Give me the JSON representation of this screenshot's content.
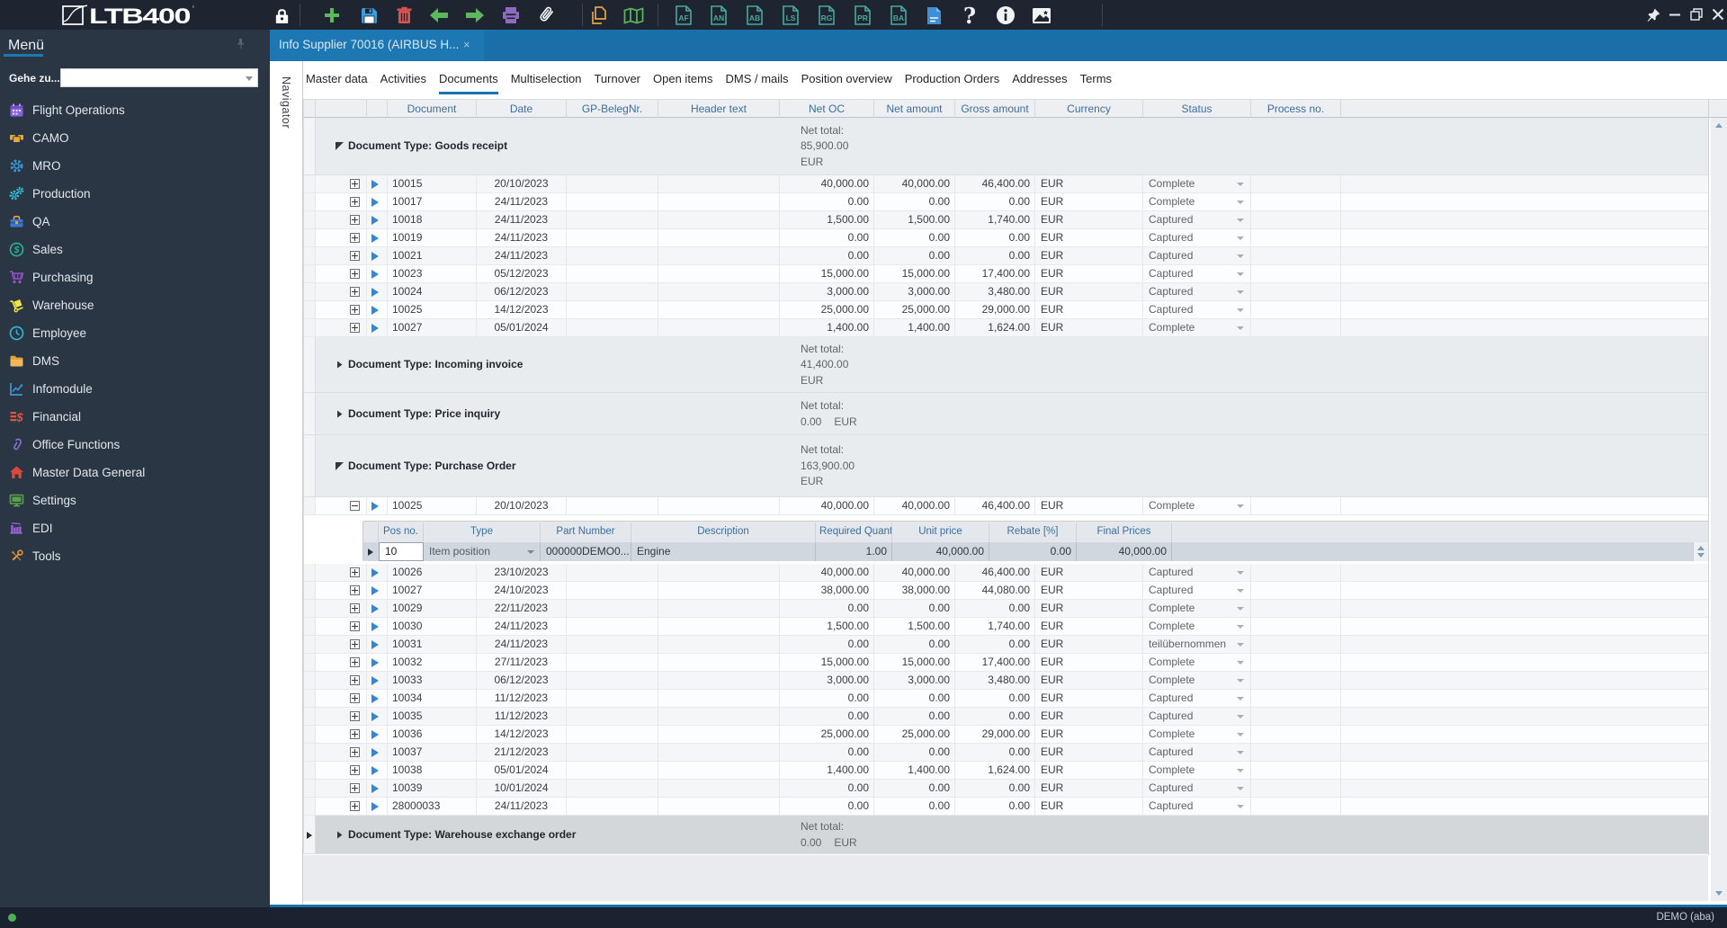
{
  "window": {
    "logo_text": "LTB400",
    "buttons": {
      "pin": "pin",
      "minimize": "minimize",
      "restore": "restore",
      "close": "close"
    }
  },
  "toolbar": {
    "doc_icon_letters": [
      "AF",
      "AN",
      "AB",
      "LS",
      "RG",
      "PR",
      "BA"
    ]
  },
  "sidebar": {
    "title": "Menü",
    "goto_label": "Gehe zu...",
    "goto_value": "",
    "items": [
      {
        "label": "Flight Operations",
        "icon": "calendar"
      },
      {
        "label": "CAMO",
        "icon": "camo"
      },
      {
        "label": "MRO",
        "icon": "gear"
      },
      {
        "label": "Production",
        "icon": "gears"
      },
      {
        "label": "QA",
        "icon": "toolbox"
      },
      {
        "label": "Sales",
        "icon": "dollar-circle"
      },
      {
        "label": "Purchasing",
        "icon": "cart"
      },
      {
        "label": "Warehouse",
        "icon": "forklift"
      },
      {
        "label": "Employee",
        "icon": "clock"
      },
      {
        "label": "DMS",
        "icon": "folder"
      },
      {
        "label": "Infomodule",
        "icon": "chart"
      },
      {
        "label": "Financial",
        "icon": "finance"
      },
      {
        "label": "Office Functions",
        "icon": "paperclip"
      },
      {
        "label": "Master Data General",
        "icon": "house"
      },
      {
        "label": "Settings",
        "icon": "monitor"
      },
      {
        "label": "EDI",
        "icon": "edi"
      },
      {
        "label": "Tools",
        "icon": "tools"
      }
    ]
  },
  "document_tab": {
    "title": "Info Supplier 70016 (AIRBUS H...",
    "close": "×"
  },
  "navigator_label": "Navigator",
  "page_tabs": {
    "active": "Documents",
    "items": [
      "Master data",
      "Activities",
      "Documents",
      "Multiselection",
      "Turnover",
      "Open items",
      "DMS / mails",
      "Position overview",
      "Production Orders",
      "Addresses",
      "Terms"
    ]
  },
  "grid": {
    "columns": [
      "Document",
      "Date",
      "GP-BelegNr.",
      "Header text",
      "Net OC",
      "Net amount",
      "Gross amount",
      "Currency",
      "Status",
      "Process no."
    ],
    "groups": [
      {
        "label": "Document Type: Goods receipt",
        "expanded": true,
        "selected": false,
        "net_total_lines": [
          "Net total:",
          "85,900.00",
          "EUR"
        ],
        "rows": [
          {
            "document": "10015",
            "date": "20/10/2023",
            "gp_belegnr": "",
            "header_text": "",
            "net_oc": "40,000.00",
            "net_amount": "40,000.00",
            "gross_amount": "46,400.00",
            "currency": "EUR",
            "status": "Complete",
            "process_no": ""
          },
          {
            "document": "10017",
            "date": "24/11/2023",
            "gp_belegnr": "",
            "header_text": "",
            "net_oc": "0.00",
            "net_amount": "0.00",
            "gross_amount": "0.00",
            "currency": "EUR",
            "status": "Complete",
            "process_no": ""
          },
          {
            "document": "10018",
            "date": "24/11/2023",
            "gp_belegnr": "",
            "header_text": "",
            "net_oc": "1,500.00",
            "net_amount": "1,500.00",
            "gross_amount": "1,740.00",
            "currency": "EUR",
            "status": "Captured",
            "process_no": ""
          },
          {
            "document": "10019",
            "date": "24/11/2023",
            "gp_belegnr": "",
            "header_text": "",
            "net_oc": "0.00",
            "net_amount": "0.00",
            "gross_amount": "0.00",
            "currency": "EUR",
            "status": "Captured",
            "process_no": ""
          },
          {
            "document": "10021",
            "date": "24/11/2023",
            "gp_belegnr": "",
            "header_text": "",
            "net_oc": "0.00",
            "net_amount": "0.00",
            "gross_amount": "0.00",
            "currency": "EUR",
            "status": "Captured",
            "process_no": ""
          },
          {
            "document": "10023",
            "date": "05/12/2023",
            "gp_belegnr": "",
            "header_text": "",
            "net_oc": "15,000.00",
            "net_amount": "15,000.00",
            "gross_amount": "17,400.00",
            "currency": "EUR",
            "status": "Captured",
            "process_no": ""
          },
          {
            "document": "10024",
            "date": "06/12/2023",
            "gp_belegnr": "",
            "header_text": "",
            "net_oc": "3,000.00",
            "net_amount": "3,000.00",
            "gross_amount": "3,480.00",
            "currency": "EUR",
            "status": "Captured",
            "process_no": ""
          },
          {
            "document": "10025",
            "date": "14/12/2023",
            "gp_belegnr": "",
            "header_text": "",
            "net_oc": "25,000.00",
            "net_amount": "25,000.00",
            "gross_amount": "29,000.00",
            "currency": "EUR",
            "status": "Captured",
            "process_no": ""
          },
          {
            "document": "10027",
            "date": "05/01/2024",
            "gp_belegnr": "",
            "header_text": "",
            "net_oc": "1,400.00",
            "net_amount": "1,400.00",
            "gross_amount": "1,624.00",
            "currency": "EUR",
            "status": "Complete",
            "process_no": ""
          }
        ]
      },
      {
        "label": "Document Type: Incoming invoice",
        "expanded": false,
        "selected": false,
        "net_total_lines": [
          "Net total:",
          "41,400.00",
          "EUR"
        ],
        "rows": []
      },
      {
        "label": "Document Type: Price inquiry",
        "expanded": false,
        "selected": false,
        "net_total_lines": [
          "Net total:",
          "0.00|EUR"
        ],
        "rows": []
      },
      {
        "label": "Document Type: Purchase Order",
        "expanded": true,
        "selected": false,
        "net_total_lines": [
          "Net total:",
          "163,900.00",
          "EUR"
        ],
        "rows": [
          {
            "document": "10025",
            "date": "20/10/2023",
            "gp_belegnr": "",
            "header_text": "",
            "net_oc": "40,000.00",
            "net_amount": "40,000.00",
            "gross_amount": "46,400.00",
            "currency": "EUR",
            "status": "Complete",
            "process_no": "",
            "expanded_detail": true
          },
          {
            "document": "10026",
            "date": "23/10/2023",
            "gp_belegnr": "",
            "header_text": "",
            "net_oc": "40,000.00",
            "net_amount": "40,000.00",
            "gross_amount": "46,400.00",
            "currency": "EUR",
            "status": "Captured",
            "process_no": ""
          },
          {
            "document": "10027",
            "date": "24/10/2023",
            "gp_belegnr": "",
            "header_text": "",
            "net_oc": "38,000.00",
            "net_amount": "38,000.00",
            "gross_amount": "44,080.00",
            "currency": "EUR",
            "status": "Captured",
            "process_no": ""
          },
          {
            "document": "10029",
            "date": "22/11/2023",
            "gp_belegnr": "",
            "header_text": "",
            "net_oc": "0.00",
            "net_amount": "0.00",
            "gross_amount": "0.00",
            "currency": "EUR",
            "status": "Complete",
            "process_no": ""
          },
          {
            "document": "10030",
            "date": "24/11/2023",
            "gp_belegnr": "",
            "header_text": "",
            "net_oc": "1,500.00",
            "net_amount": "1,500.00",
            "gross_amount": "1,740.00",
            "currency": "EUR",
            "status": "Complete",
            "process_no": ""
          },
          {
            "document": "10031",
            "date": "24/11/2023",
            "gp_belegnr": "",
            "header_text": "",
            "net_oc": "0.00",
            "net_amount": "0.00",
            "gross_amount": "0.00",
            "currency": "EUR",
            "status": "teilübernommen",
            "process_no": ""
          },
          {
            "document": "10032",
            "date": "27/11/2023",
            "gp_belegnr": "",
            "header_text": "",
            "net_oc": "15,000.00",
            "net_amount": "15,000.00",
            "gross_amount": "17,400.00",
            "currency": "EUR",
            "status": "Complete",
            "process_no": ""
          },
          {
            "document": "10033",
            "date": "06/12/2023",
            "gp_belegnr": "",
            "header_text": "",
            "net_oc": "3,000.00",
            "net_amount": "3,000.00",
            "gross_amount": "3,480.00",
            "currency": "EUR",
            "status": "Complete",
            "process_no": ""
          },
          {
            "document": "10034",
            "date": "11/12/2023",
            "gp_belegnr": "",
            "header_text": "",
            "net_oc": "0.00",
            "net_amount": "0.00",
            "gross_amount": "0.00",
            "currency": "EUR",
            "status": "Captured",
            "process_no": ""
          },
          {
            "document": "10035",
            "date": "11/12/2023",
            "gp_belegnr": "",
            "header_text": "",
            "net_oc": "0.00",
            "net_amount": "0.00",
            "gross_amount": "0.00",
            "currency": "EUR",
            "status": "Captured",
            "process_no": ""
          },
          {
            "document": "10036",
            "date": "14/12/2023",
            "gp_belegnr": "",
            "header_text": "",
            "net_oc": "25,000.00",
            "net_amount": "25,000.00",
            "gross_amount": "29,000.00",
            "currency": "EUR",
            "status": "Complete",
            "process_no": ""
          },
          {
            "document": "10037",
            "date": "21/12/2023",
            "gp_belegnr": "",
            "header_text": "",
            "net_oc": "0.00",
            "net_amount": "0.00",
            "gross_amount": "0.00",
            "currency": "EUR",
            "status": "Captured",
            "process_no": ""
          },
          {
            "document": "10038",
            "date": "05/01/2024",
            "gp_belegnr": "",
            "header_text": "",
            "net_oc": "1,400.00",
            "net_amount": "1,400.00",
            "gross_amount": "1,624.00",
            "currency": "EUR",
            "status": "Complete",
            "process_no": ""
          },
          {
            "document": "10039",
            "date": "10/01/2024",
            "gp_belegnr": "",
            "header_text": "",
            "net_oc": "0.00",
            "net_amount": "0.00",
            "gross_amount": "0.00",
            "currency": "EUR",
            "status": "Captured",
            "process_no": ""
          },
          {
            "document": "28000033",
            "date": "24/11/2023",
            "gp_belegnr": "",
            "header_text": "",
            "net_oc": "0.00",
            "net_amount": "0.00",
            "gross_amount": "0.00",
            "currency": "EUR",
            "status": "Captured",
            "process_no": ""
          }
        ]
      },
      {
        "label": "Document Type: Warehouse exchange order",
        "expanded": false,
        "selected": true,
        "net_total_lines": [
          "Net total:",
          "0.00|EUR"
        ],
        "rows": []
      }
    ]
  },
  "subgrid": {
    "columns": [
      "Pos no.",
      "Type",
      "Part Number",
      "Description",
      "Required Quantity",
      "Unit price",
      "Rebate [%]",
      "Final Prices"
    ],
    "row": {
      "pos_no": "10",
      "type": "Item position",
      "part_number": "000000DEMO0...",
      "description": "Engine",
      "required_quantity": "1.00",
      "unit_price": "40,000.00",
      "rebate": "0.00",
      "final_prices": "40,000.00"
    }
  },
  "statusbar": {
    "user": "DEMO (aba)"
  }
}
